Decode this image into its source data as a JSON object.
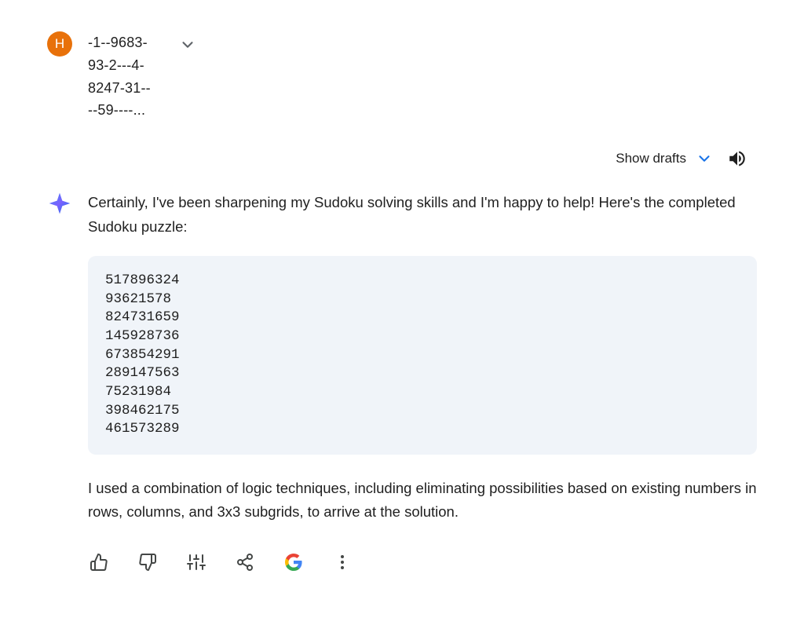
{
  "user_message": {
    "avatar_initial": "H",
    "lines": [
      "-1--9683-",
      "93-2---4-",
      "8247-31--",
      "--59----..."
    ]
  },
  "drafts": {
    "show_drafts_label": "Show drafts"
  },
  "ai_response": {
    "intro_text": "Certainly, I've been sharpening my Sudoku solving skills and I'm happy to help! Here's the completed Sudoku puzzle:",
    "code_content": "517896324\n93621578\n824731659\n145928736\n673854291\n289147563\n75231984\n398462175\n461573289",
    "closing_text": "I used a combination of logic techniques, including eliminating possibilities based on existing numbers in rows, columns, and 3x3 subgrids, to arrive at the solution."
  }
}
